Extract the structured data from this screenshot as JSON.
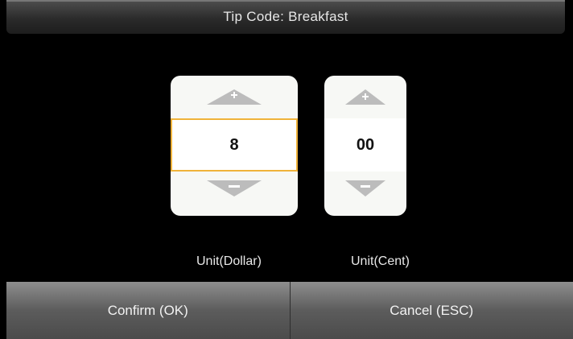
{
  "header": {
    "title": "Tip Code: Breakfast"
  },
  "spinners": {
    "dollar": {
      "value": "8",
      "unit_label": "Unit(Dollar)"
    },
    "cent": {
      "value": "00",
      "unit_label": "Unit(Cent)"
    }
  },
  "footer": {
    "confirm_label": "Confirm (OK)",
    "cancel_label": "Cancel (ESC)"
  },
  "colors": {
    "selected_border": "#f0b33a",
    "spinner_bg": "#f7f8f5"
  }
}
